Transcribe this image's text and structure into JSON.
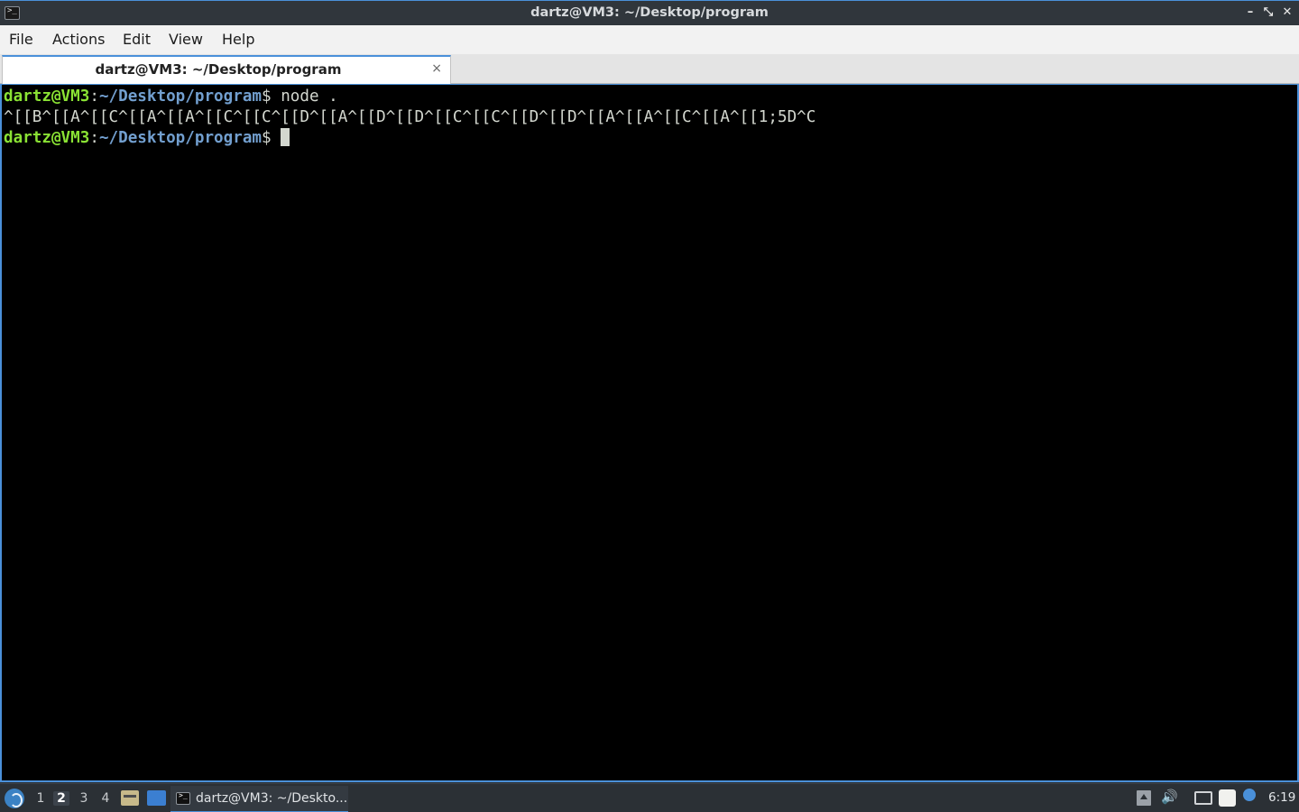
{
  "window": {
    "title": "dartz@VM3: ~/Desktop/program",
    "app_icon": "terminal-icon",
    "controls": {
      "minimize": "–",
      "maximize": "⤡",
      "close": "✕"
    }
  },
  "menu": {
    "file": "File",
    "actions": "Actions",
    "edit": "Edit",
    "view": "View",
    "help": "Help"
  },
  "tab": {
    "label": "dartz@VM3: ~/Desktop/program",
    "close": "×"
  },
  "terminal": {
    "line1": {
      "user": "dartz@VM3",
      "colon": ":",
      "path": "~/Desktop/program",
      "dollar": "$",
      "command": " node ."
    },
    "line2": {
      "output": "^[[B^[[A^[[C^[[A^[[A^[[C^[[C^[[D^[[A^[[D^[[D^[[C^[[C^[[D^[[D^[[A^[[A^[[C^[[A^[[1;5D^C"
    },
    "line3": {
      "user": "dartz@VM3",
      "colon": ":",
      "path": "~/Desktop/program",
      "dollar": "$",
      "command": " "
    }
  },
  "colors": {
    "prompt_user": "#8ae234",
    "prompt_path": "#729fcf",
    "terminal_bg": "#000000",
    "accent": "#4a90d9"
  },
  "taskbar": {
    "desktops": [
      "1",
      "2",
      "3",
      "4"
    ],
    "active_desktop": "2",
    "task_label": "dartz@VM3: ~/Deskto...",
    "clock": "6:19",
    "tray_icons": [
      "tray-arrow-icon",
      "volume-icon",
      "network-icon",
      "clipboard-icon",
      "notification-icon"
    ]
  }
}
